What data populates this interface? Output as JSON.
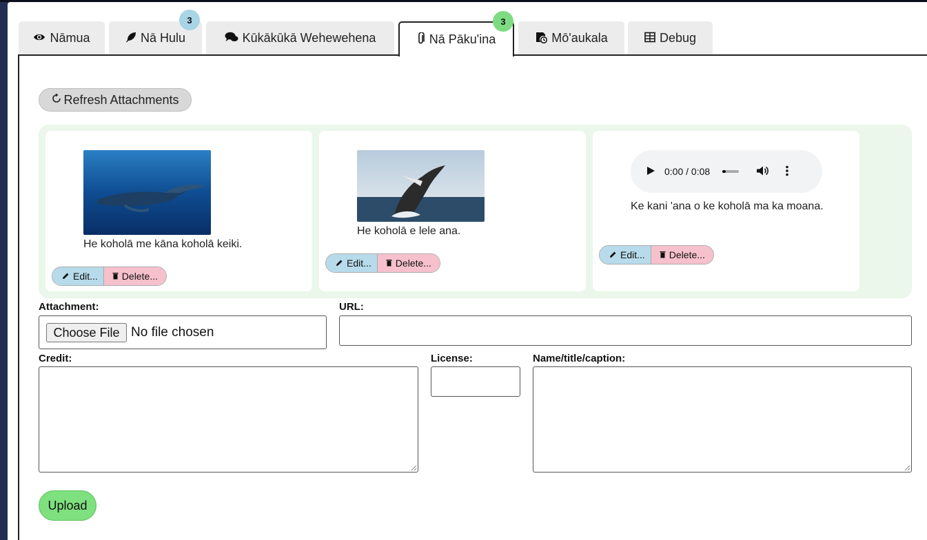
{
  "tabs": [
    {
      "label": "Nāmua",
      "icon": "eye-icon",
      "active": false
    },
    {
      "label": "Nā Hulu",
      "icon": "feather-icon",
      "active": false,
      "badge": "3"
    },
    {
      "label": "Kūkākūkā Wehewehena",
      "icon": "chat-icon",
      "active": false
    },
    {
      "label": "Nā Pāku'ina",
      "icon": "paperclip-icon",
      "active": true,
      "badge": "3"
    },
    {
      "label": "Mō'aukala",
      "icon": "history-icon",
      "active": false
    },
    {
      "label": "Debug",
      "icon": "table-icon",
      "active": false
    }
  ],
  "toolbar": {
    "refresh_label": "Refresh Attachments"
  },
  "attachments": [
    {
      "type": "image",
      "caption": "He koholā me kāna koholā keiki.",
      "edit_label": "Edit...",
      "delete_label": "Delete..."
    },
    {
      "type": "image",
      "caption": "He koholā e lele ana.",
      "edit_label": "Edit...",
      "delete_label": "Delete..."
    },
    {
      "type": "audio",
      "time": "0:00 / 0:08",
      "caption": "Ke kani 'ana o ke koholā ma ka moana.",
      "edit_label": "Edit...",
      "delete_label": "Delete..."
    }
  ],
  "form": {
    "attachment_label": "Attachment:",
    "choose_file_label": "Choose File",
    "no_file_text": "No file chosen",
    "url_label": "URL:",
    "url_value": "",
    "credit_label": "Credit:",
    "credit_value": "",
    "license_label": "License:",
    "license_value": "",
    "caption_label": "Name/title/caption:",
    "caption_value": "",
    "upload_label": "Upload"
  },
  "colors": {
    "badge_blue": "#a8d4e6",
    "badge_green": "#7ddc82",
    "edit_bg": "#b7dbea",
    "delete_bg": "#f6c1cc",
    "upload_bg": "#7ee07e",
    "gallery_bg": "#eaf7ea"
  }
}
